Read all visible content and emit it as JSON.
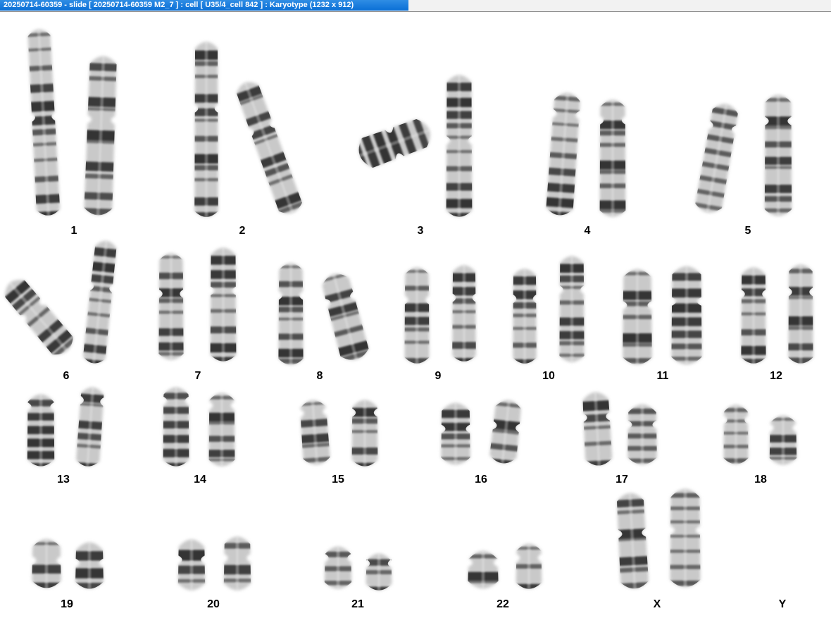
{
  "window": {
    "title": "20250714-60359 - slide [ 20250714-60359 M2_7 ] : cell [ U35/4_cell 842 ] : Karyotype  (1232 x 912)"
  },
  "karyotype": {
    "labels": {
      "chr1": "1",
      "chr2": "2",
      "chr3": "3",
      "chr4": "4",
      "chr5": "5",
      "chr6": "6",
      "chr7": "7",
      "chr8": "8",
      "chr9": "9",
      "chr10": "10",
      "chr11": "11",
      "chr12": "12",
      "chr13": "13",
      "chr14": "14",
      "chr15": "15",
      "chr16": "16",
      "chr17": "17",
      "chr18": "18",
      "chr19": "19",
      "chr20": "20",
      "chr21": "21",
      "chr22": "22",
      "chrX": "X",
      "chrY": "Y"
    },
    "colors": {
      "background": "#ffffff",
      "chromosome_light": "#c9c9c9",
      "chromosome_band": "#2b2b2b",
      "title_bar": "#0a6fd6"
    }
  }
}
